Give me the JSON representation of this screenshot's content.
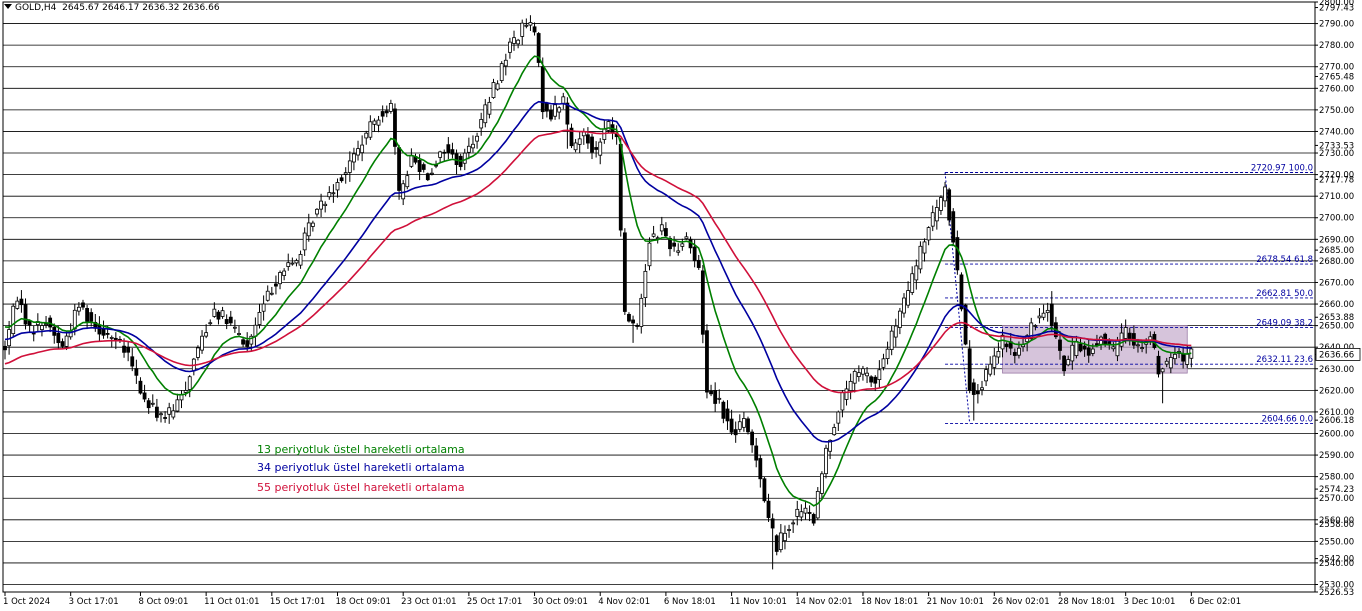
{
  "header": {
    "symbol": "GOLD,H4",
    "ohlc": "2645.67 2646.17 2636.32 2636.66"
  },
  "legend": [
    {
      "label": "13 periyotluk üstel hareketli ortalama",
      "color": "#008000"
    },
    {
      "label": "34 periyotluk üstel hareketli ortalama",
      "color": "#0000a0"
    },
    {
      "label": "55 periyotluk üstel hareketli ortalama",
      "color": "#d0103a"
    }
  ],
  "chart_data": {
    "type": "candlestick",
    "ylim": [
      2526.53,
      2800.0
    ],
    "grid": true,
    "y_ticks": [
      "2800.00",
      "2797.43",
      "2790.00",
      "2780.00",
      "2770.00",
      "2765.48",
      "2760.00",
      "2750.00",
      "2740.00",
      "2733.53",
      "2730.00",
      "2720.00",
      "2717.78",
      "2710.00",
      "2700.00",
      "2690.00",
      "2685.00",
      "2680.00",
      "2670.00",
      "2660.00",
      "2653.88",
      "2650.00",
      "2640.00",
      "2636.66",
      "2630.00",
      "2620.00",
      "2610.00",
      "2606.18",
      "2600.00",
      "2590.00",
      "2580.00",
      "2574.23",
      "2570.00",
      "2560.00",
      "2558.00",
      "2550.00",
      "2542.00",
      "2540.00",
      "2530.00",
      "2526.53"
    ],
    "price_label": {
      "value": 2636.66,
      "text": "2636.66"
    },
    "x_ticks": [
      {
        "i": 0,
        "label": "1 Oct 2024"
      },
      {
        "i": 16,
        "label": "3 Oct 17:01"
      },
      {
        "i": 33,
        "label": "8 Oct 09:01"
      },
      {
        "i": 49,
        "label": "11 Oct 01:01"
      },
      {
        "i": 65,
        "label": "15 Oct 17:01"
      },
      {
        "i": 81,
        "label": "18 Oct 09:01"
      },
      {
        "i": 97,
        "label": "23 Oct 01:01"
      },
      {
        "i": 113,
        "label": "25 Oct 17:01"
      },
      {
        "i": 129,
        "label": "30 Oct 09:01"
      },
      {
        "i": 145,
        "label": "4 Nov 02:01"
      },
      {
        "i": 161,
        "label": "6 Nov 18:01"
      },
      {
        "i": 177,
        "label": "11 Nov 10:01"
      },
      {
        "i": 193,
        "label": "14 Nov 02:01"
      },
      {
        "i": 209,
        "label": "18 Nov 18:01"
      },
      {
        "i": 225,
        "label": "21 Nov 10:01"
      },
      {
        "i": 241,
        "label": "26 Nov 02:01"
      },
      {
        "i": 257,
        "label": "28 Nov 18:01"
      },
      {
        "i": 273,
        "label": "3 Dec 10:01"
      },
      {
        "i": 289,
        "label": "6 Dec 02:01"
      }
    ],
    "anchors": [
      {
        "i": 0,
        "p": 2640
      },
      {
        "i": 3,
        "p": 2664
      },
      {
        "i": 6,
        "p": 2648
      },
      {
        "i": 10,
        "p": 2652
      },
      {
        "i": 14,
        "p": 2640
      },
      {
        "i": 18,
        "p": 2660
      },
      {
        "i": 22,
        "p": 2650
      },
      {
        "i": 26,
        "p": 2645
      },
      {
        "i": 30,
        "p": 2636
      },
      {
        "i": 34,
        "p": 2615
      },
      {
        "i": 38,
        "p": 2608
      },
      {
        "i": 41,
        "p": 2610
      },
      {
        "i": 44,
        "p": 2622
      },
      {
        "i": 47,
        "p": 2640
      },
      {
        "i": 51,
        "p": 2658
      },
      {
        "i": 55,
        "p": 2650
      },
      {
        "i": 59,
        "p": 2640
      },
      {
        "i": 63,
        "p": 2660
      },
      {
        "i": 67,
        "p": 2675
      },
      {
        "i": 71,
        "p": 2680
      },
      {
        "i": 75,
        "p": 2700
      },
      {
        "i": 79,
        "p": 2712
      },
      {
        "i": 83,
        "p": 2722
      },
      {
        "i": 87,
        "p": 2735
      },
      {
        "i": 91,
        "p": 2748
      },
      {
        "i": 94,
        "p": 2752
      },
      {
        "i": 96,
        "p": 2710
      },
      {
        "i": 99,
        "p": 2728
      },
      {
        "i": 103,
        "p": 2720
      },
      {
        "i": 107,
        "p": 2732
      },
      {
        "i": 111,
        "p": 2725
      },
      {
        "i": 115,
        "p": 2740
      },
      {
        "i": 119,
        "p": 2760
      },
      {
        "i": 123,
        "p": 2780
      },
      {
        "i": 127,
        "p": 2790
      },
      {
        "i": 129,
        "p": 2786
      },
      {
        "i": 131,
        "p": 2752
      },
      {
        "i": 133,
        "p": 2748
      },
      {
        "i": 136,
        "p": 2755
      },
      {
        "i": 138,
        "p": 2732
      },
      {
        "i": 141,
        "p": 2740
      },
      {
        "i": 144,
        "p": 2730
      },
      {
        "i": 147,
        "p": 2745
      },
      {
        "i": 149,
        "p": 2735
      },
      {
        "i": 151,
        "p": 2655
      },
      {
        "i": 154,
        "p": 2650
      },
      {
        "i": 157,
        "p": 2690
      },
      {
        "i": 160,
        "p": 2695
      },
      {
        "i": 163,
        "p": 2685
      },
      {
        "i": 166,
        "p": 2692
      },
      {
        "i": 169,
        "p": 2675
      },
      {
        "i": 171,
        "p": 2620
      },
      {
        "i": 174,
        "p": 2615
      },
      {
        "i": 177,
        "p": 2600
      },
      {
        "i": 180,
        "p": 2605
      },
      {
        "i": 183,
        "p": 2590
      },
      {
        "i": 186,
        "p": 2560
      },
      {
        "i": 188,
        "p": 2548
      },
      {
        "i": 191,
        "p": 2558
      },
      {
        "i": 194,
        "p": 2565
      },
      {
        "i": 197,
        "p": 2560
      },
      {
        "i": 200,
        "p": 2592
      },
      {
        "i": 203,
        "p": 2612
      },
      {
        "i": 206,
        "p": 2625
      },
      {
        "i": 209,
        "p": 2628
      },
      {
        "i": 212,
        "p": 2624
      },
      {
        "i": 215,
        "p": 2640
      },
      {
        "i": 218,
        "p": 2655
      },
      {
        "i": 221,
        "p": 2672
      },
      {
        "i": 224,
        "p": 2690
      },
      {
        "i": 227,
        "p": 2705
      },
      {
        "i": 229,
        "p": 2712
      },
      {
        "i": 231,
        "p": 2690
      },
      {
        "i": 233,
        "p": 2660
      },
      {
        "i": 235,
        "p": 2622
      },
      {
        "i": 237,
        "p": 2620
      },
      {
        "i": 240,
        "p": 2630
      },
      {
        "i": 243,
        "p": 2643
      },
      {
        "i": 246,
        "p": 2636
      },
      {
        "i": 249,
        "p": 2645
      },
      {
        "i": 252,
        "p": 2655
      },
      {
        "i": 254,
        "p": 2660
      },
      {
        "i": 256,
        "p": 2645
      },
      {
        "i": 258,
        "p": 2630
      },
      {
        "i": 261,
        "p": 2642
      },
      {
        "i": 264,
        "p": 2637
      },
      {
        "i": 267,
        "p": 2645
      },
      {
        "i": 270,
        "p": 2638
      },
      {
        "i": 273,
        "p": 2648
      },
      {
        "i": 276,
        "p": 2640
      },
      {
        "i": 279,
        "p": 2645
      },
      {
        "i": 281,
        "p": 2630
      },
      {
        "i": 283,
        "p": 2632
      },
      {
        "i": 285,
        "p": 2638
      },
      {
        "i": 287,
        "p": 2634
      },
      {
        "i": 289,
        "p": 2636.66
      }
    ],
    "spikes": [
      {
        "i": 137,
        "p": 2732
      },
      {
        "i": 153,
        "p": 2642
      },
      {
        "i": 187,
        "p": 2537
      },
      {
        "i": 236,
        "p": 2606
      },
      {
        "i": 282,
        "p": 2614
      },
      {
        "i": 255,
        "p": 2666
      }
    ],
    "fibonacci": {
      "levels": [
        {
          "value": 2720.97,
          "label": "2720.97 100.0"
        },
        {
          "value": 2678.54,
          "label": "2678.54 61.8"
        },
        {
          "value": 2662.81,
          "label": "2662.81 50.0"
        },
        {
          "value": 2649.09,
          "label": "2649.09 38.2"
        },
        {
          "value": 2632.11,
          "label": "2632.11 23.6"
        },
        {
          "value": 2604.66,
          "label": "2604.66 0.0"
        }
      ],
      "from_i": 229,
      "color": "#0000a0"
    },
    "box": {
      "from_i": 243,
      "to_i": 288,
      "high": 2650,
      "low": 2628,
      "color": "#c8b0cf"
    },
    "series": [
      {
        "name": "13 periyotluk üstel hareketli ortalama",
        "period": 13,
        "color": "#008000"
      },
      {
        "name": "34 periyotluk üstel hareketli ortalama",
        "period": 34,
        "color": "#0000a0"
      },
      {
        "name": "55 periyotluk üstel hareketli ortalama",
        "period": 55,
        "color": "#d0103a"
      }
    ]
  }
}
